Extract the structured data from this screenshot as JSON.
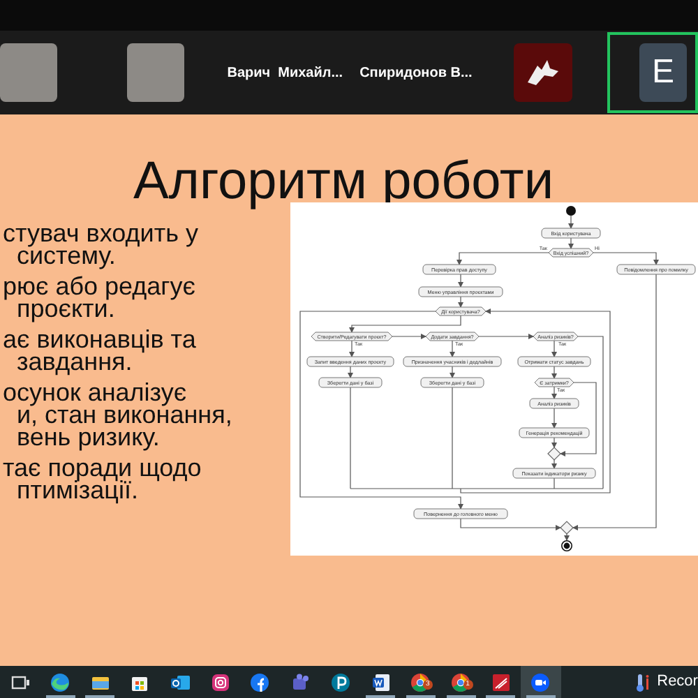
{
  "participants": [
    {
      "kind": "photo"
    },
    {
      "kind": "photo"
    },
    {
      "kind": "name",
      "label": "Варич  Михайл..."
    },
    {
      "kind": "name",
      "label": "Спиридонов В..."
    },
    {
      "kind": "avatar-image"
    },
    {
      "kind": "initial",
      "label": "E",
      "speaking": true
    }
  ],
  "slide": {
    "title": "Алгоритм роботи",
    "bullets": [
      {
        "lines": [
          "стувач входить у",
          "систему."
        ]
      },
      {
        "lines": [
          "рює або редагує",
          "проєкти."
        ]
      },
      {
        "lines": [
          "ає виконавців та",
          "завдання."
        ]
      },
      {
        "lines": [
          "осунок аналізує",
          "и,   стан виконання,",
          "вень ризику."
        ]
      },
      {
        "lines": [
          "тає поради щодо",
          "птимізації."
        ]
      }
    ],
    "flowchart": {
      "nodes": [
        {
          "kind": "start"
        },
        {
          "kind": "action",
          "label": "Вхід користувача"
        },
        {
          "kind": "decision",
          "label": "Вхід успішний?"
        },
        {
          "kind": "action",
          "label": "Перевірка прав доступу"
        },
        {
          "kind": "action",
          "label": "Повідомлення про помилку"
        },
        {
          "kind": "action",
          "label": "Меню управління проєктами"
        },
        {
          "kind": "decision",
          "label": "Дії користувача?"
        },
        {
          "kind": "decision",
          "label": "Створити/Редагувати проєкт?"
        },
        {
          "kind": "decision",
          "label": "Додати завдання?"
        },
        {
          "kind": "decision",
          "label": "Аналіз ризиків?"
        },
        {
          "kind": "action",
          "label": "Запит введення даних проєкту"
        },
        {
          "kind": "action",
          "label": "Призначення учасників і дедлайнів"
        },
        {
          "kind": "action",
          "label": "Отримати статус завдань"
        },
        {
          "kind": "action",
          "label": "Зберегти дані у базі"
        },
        {
          "kind": "action",
          "label": "Зберегти дані у базі"
        },
        {
          "kind": "decision",
          "label": "Є затримки?"
        },
        {
          "kind": "action",
          "label": "Аналіз ризиків"
        },
        {
          "kind": "action",
          "label": "Генерація рекомендацій"
        },
        {
          "kind": "merge"
        },
        {
          "kind": "action",
          "label": "Показати індикатори ризику"
        },
        {
          "kind": "action",
          "label": "Повернення до головного меню"
        },
        {
          "kind": "merge"
        },
        {
          "kind": "end"
        }
      ],
      "edge_labels": [
        "Так",
        "Ні",
        "Так",
        "Так",
        "Так",
        "Так"
      ]
    }
  },
  "taskbar": {
    "items": [
      {
        "kind": "task-view",
        "running": false,
        "focused": false
      },
      {
        "kind": "edge",
        "running": true,
        "focused": false
      },
      {
        "kind": "folder",
        "running": true,
        "focused": false
      },
      {
        "kind": "store",
        "running": false,
        "focused": false
      },
      {
        "kind": "mail",
        "running": false,
        "focused": false
      },
      {
        "kind": "camera",
        "running": false,
        "focused": false
      },
      {
        "kind": "f-logo",
        "running": false,
        "focused": false
      },
      {
        "kind": "people",
        "running": false,
        "focused": false
      },
      {
        "kind": "p-logo",
        "running": false,
        "focused": false
      },
      {
        "kind": "word",
        "running": true,
        "focused": false
      },
      {
        "kind": "chrome",
        "running": true,
        "focused": false,
        "badge": "3"
      },
      {
        "kind": "chrome",
        "running": true,
        "focused": false,
        "badge": "1"
      },
      {
        "kind": "pdf",
        "running": true,
        "focused": false
      },
      {
        "kind": "video",
        "running": true,
        "focused": true
      }
    ],
    "tray_label": "Recor"
  }
}
